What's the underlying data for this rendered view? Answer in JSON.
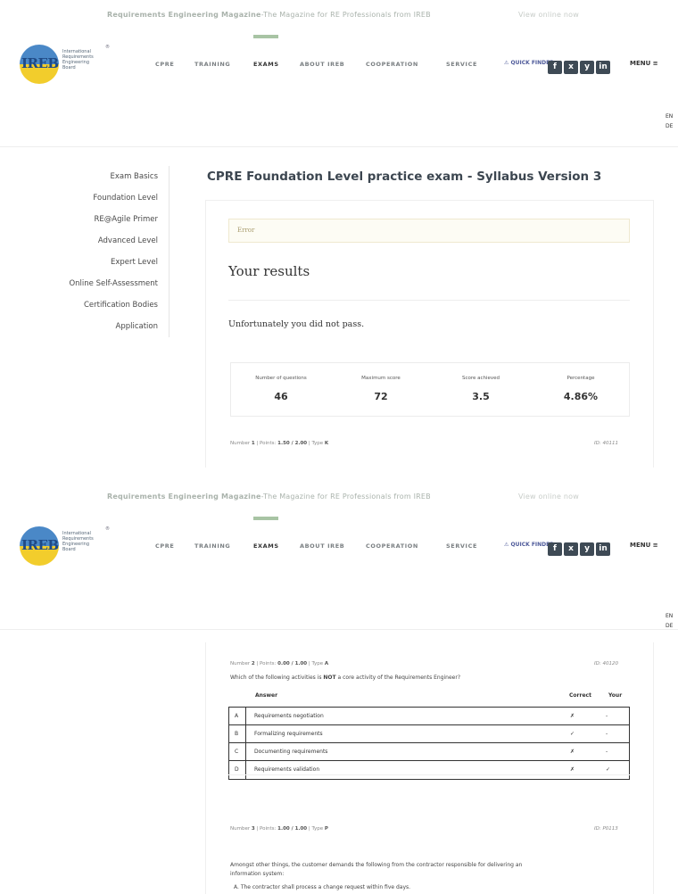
{
  "header": {
    "magazine_bold": "Requirements Engineering Magazine",
    "magazine_rest": "-The Magazine for RE Professionals from IREB",
    "view_online": "View online now",
    "logo_text": "IREB",
    "logo_sub": [
      "International",
      "Requirements",
      "Engineering",
      "Board"
    ],
    "registered": "®",
    "nav": [
      "CPRE",
      "TRAINING",
      "EXAMS",
      "ABOUT IREB",
      "COOPERATION",
      "SERVICE"
    ],
    "active_nav": "EXAMS",
    "quick_finder": "QUICK FINDER",
    "social": [
      "f",
      "x",
      "y",
      "in"
    ],
    "menu": "MENU",
    "lang": [
      "EN",
      "DE"
    ]
  },
  "sidebar": {
    "items": [
      "Exam Basics",
      "Foundation Level",
      "RE@Agile Primer",
      "Advanced Level",
      "Expert Level",
      "Online Self-Assessment",
      "Certification Bodies",
      "Application"
    ]
  },
  "main": {
    "title": "CPRE Foundation Level practice exam - Syllabus Version 3",
    "error": "Error",
    "results_title": "Your results",
    "fail_message": "Unfortunately you did not pass.",
    "stats": [
      {
        "label": "Number of questions",
        "value": "46"
      },
      {
        "label": "Maximum score",
        "value": "72"
      },
      {
        "label": "Score achieved",
        "value": "3.5"
      },
      {
        "label": "Percentage",
        "value": "4.86%"
      }
    ],
    "q1_meta": {
      "number": "1",
      "points": "1.50 / 2.00",
      "type": "K",
      "id": "ID: 40111"
    }
  },
  "question2": {
    "meta": {
      "number": "2",
      "points": "0.00 / 1.00",
      "type": "A",
      "id": "ID: 40120"
    },
    "text_pre": "Which of the following activities is ",
    "text_bold": "NOT",
    "text_post": " a core activity of the Requirements Engineer?",
    "headers": {
      "answer": "Answer",
      "correct": "Correct",
      "your": "Your"
    },
    "answers": [
      {
        "letter": "A",
        "text": "Requirements negotiation",
        "correct": "✗",
        "your": "-"
      },
      {
        "letter": "B",
        "text": "Formalizing requirements",
        "correct": "✓",
        "your": "-"
      },
      {
        "letter": "C",
        "text": "Documenting requirements",
        "correct": "✗",
        "your": "-"
      },
      {
        "letter": "D",
        "text": "Requirements validation",
        "correct": "✗",
        "your": "✓"
      }
    ]
  },
  "question3": {
    "meta": {
      "number": "3",
      "points": "1.00 / 1.00",
      "type": "P",
      "id": "ID: P0113"
    },
    "text_line1": "Amongst other things, the customer demands the following from the contractor responsible for delivering an",
    "text_line2": "information system:",
    "text_line3": "A. The contractor shall process a change request within five days."
  }
}
